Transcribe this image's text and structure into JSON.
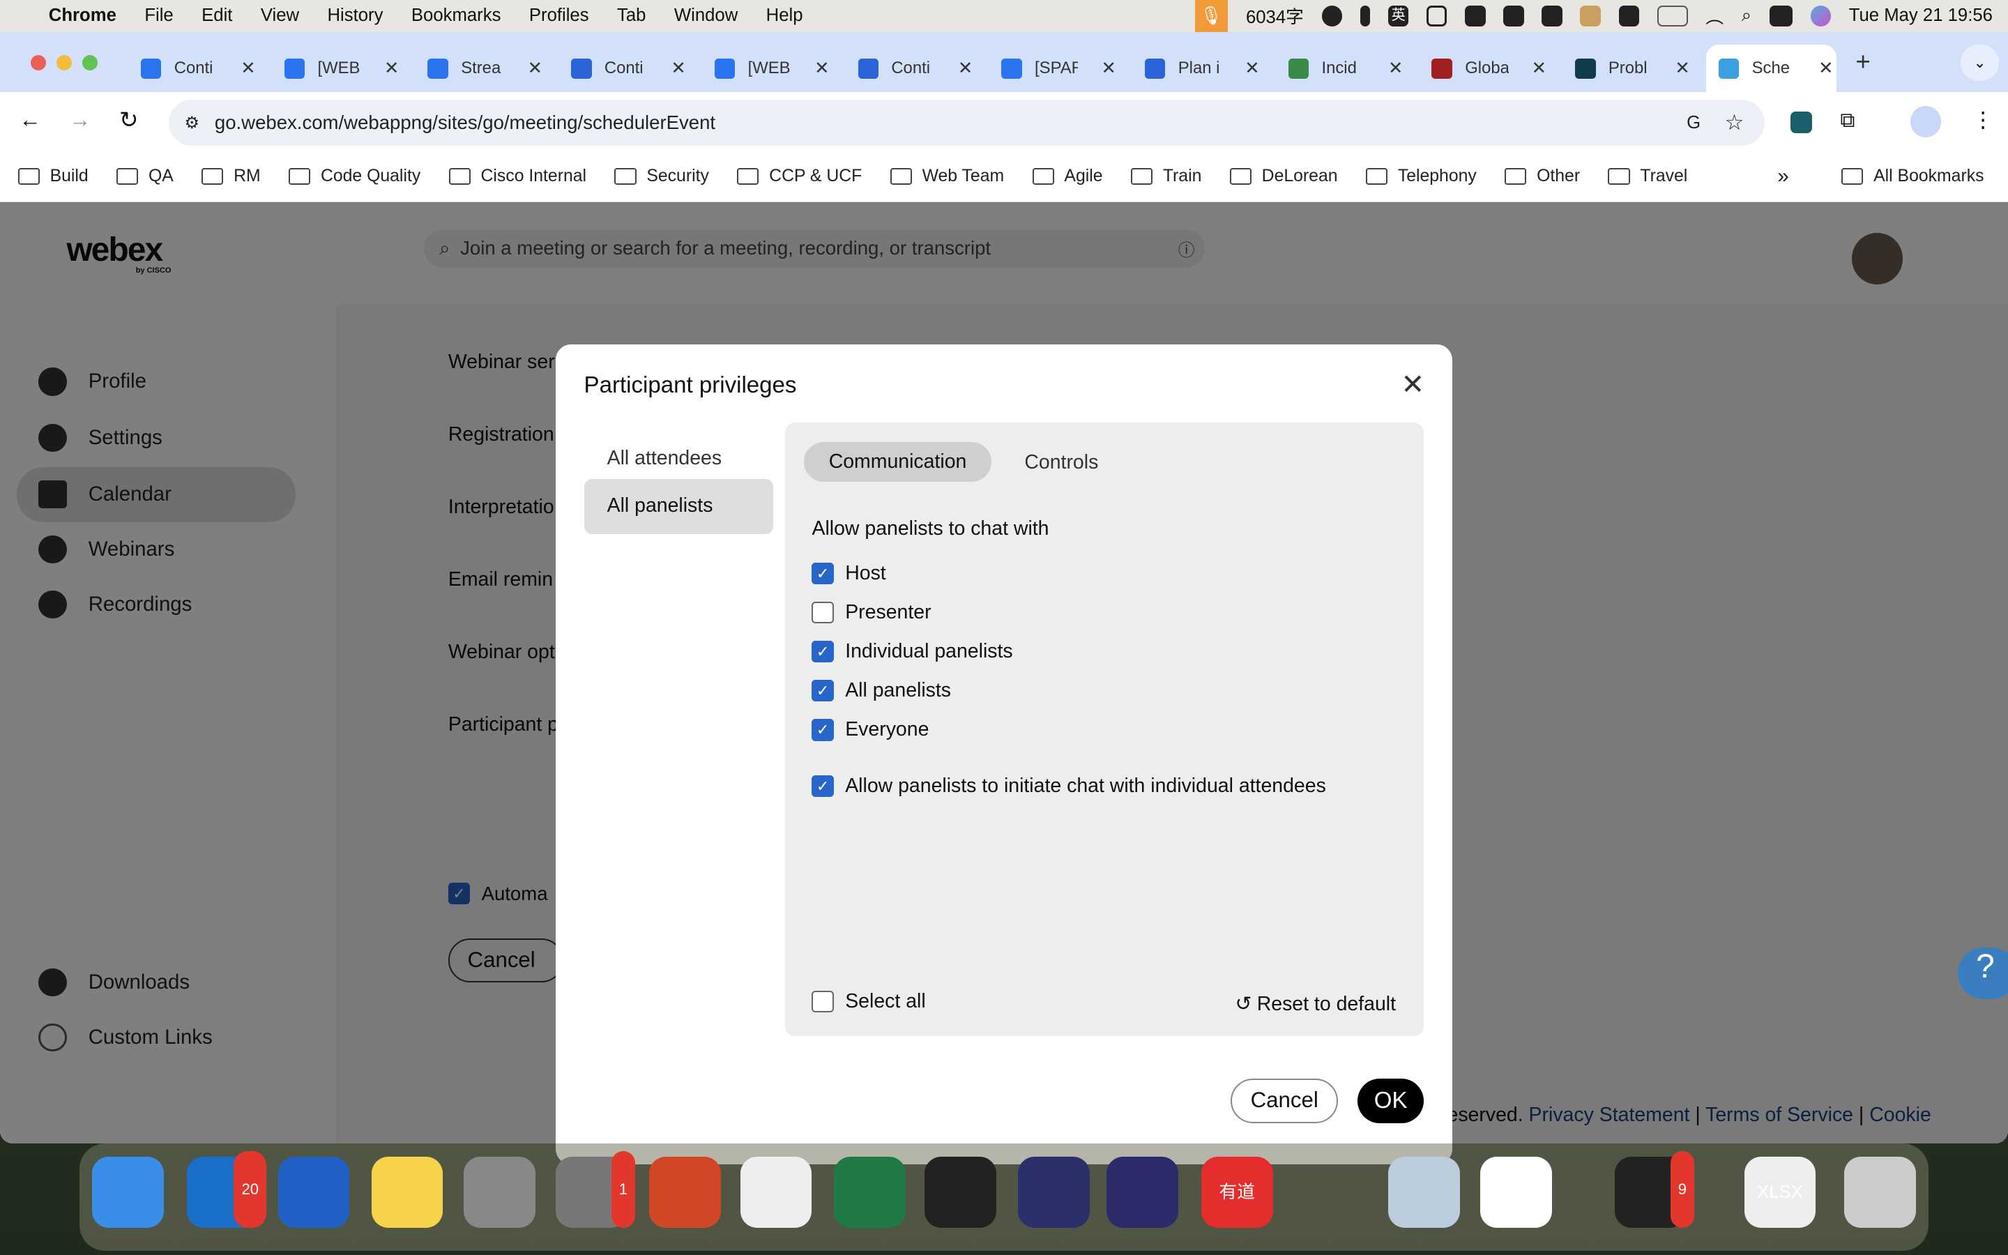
{
  "menubar": {
    "app": "Chrome",
    "items": [
      "File",
      "Edit",
      "View",
      "History",
      "Bookmarks",
      "Profiles",
      "Tab",
      "Window",
      "Help"
    ],
    "word_count": "6034字",
    "ime": "英",
    "datetime": "Tue May 21  19:56"
  },
  "tabs": [
    {
      "title": "Conti",
      "icon": "jira"
    },
    {
      "title": "[WEB",
      "icon": "jira"
    },
    {
      "title": "Strea",
      "icon": "jira"
    },
    {
      "title": "Conti",
      "icon": "confluence"
    },
    {
      "title": "[WEB",
      "icon": "jira"
    },
    {
      "title": "Conti",
      "icon": "confluence"
    },
    {
      "title": "[SPAR",
      "icon": "jira"
    },
    {
      "title": "Plan i",
      "icon": "confluence"
    },
    {
      "title": "Incid",
      "icon": "incident"
    },
    {
      "title": "Globa",
      "icon": "cisco"
    },
    {
      "title": "Probl",
      "icon": "problem"
    },
    {
      "title": "Sche",
      "icon": "webex",
      "active": true
    }
  ],
  "address": {
    "url": "go.webex.com/webappng/sites/go/meeting/schedulerEvent"
  },
  "bookmarks": [
    "Build",
    "QA",
    "RM",
    "Code Quality",
    "Cisco Internal",
    "Security",
    "CCP & UCF",
    "Web Team",
    "Agile",
    "Train",
    "DeLorean",
    "Telephony",
    "Other",
    "Travel"
  ],
  "all_bookmarks": "All Bookmarks",
  "webex": {
    "logo": "webex",
    "logo_sub": "by CISCO",
    "search_placeholder": "Join a meeting or search for a meeting, recording, or transcript",
    "sidebar": [
      {
        "label": "Profile"
      },
      {
        "label": "Settings"
      },
      {
        "label": "Calendar",
        "active": true
      },
      {
        "label": "Webinars"
      },
      {
        "label": "Recordings"
      }
    ],
    "sidebar_bottom": [
      {
        "label": "Downloads"
      },
      {
        "label": "Custom Links"
      }
    ],
    "sections": [
      "Webinar ser",
      "Registration",
      "Interpretatio",
      "Email remin",
      "Webinar opt",
      "Participant p"
    ],
    "auto_label": "Automa",
    "cancel": "Cancel",
    "footer": {
      "text": "eserved.",
      "links": [
        "Privacy Statement",
        "Terms of Service",
        "Cookie"
      ]
    }
  },
  "modal": {
    "title": "Participant privileges",
    "roles": [
      {
        "label": "All attendees"
      },
      {
        "label": "All panelists",
        "active": true
      }
    ],
    "tabs": [
      {
        "label": "Communication",
        "active": true
      },
      {
        "label": "Controls"
      }
    ],
    "heading": "Allow panelists to chat with",
    "options": [
      {
        "label": "Host",
        "checked": true
      },
      {
        "label": "Presenter",
        "checked": false
      },
      {
        "label": "Individual panelists",
        "checked": true
      },
      {
        "label": "All panelists",
        "checked": true
      },
      {
        "label": "Everyone",
        "checked": true
      }
    ],
    "initiate": {
      "label": "Allow panelists to initiate chat with individual attendees",
      "checked": true
    },
    "select_all": "Select all",
    "reset": "Reset to default",
    "cancel": "Cancel",
    "ok": "OK"
  },
  "dock": [
    {
      "name": "Finder"
    },
    {
      "name": "Outlook",
      "badge": "20"
    },
    {
      "name": "Word"
    },
    {
      "name": "Notes"
    },
    {
      "name": "Launchpad"
    },
    {
      "name": "System Settings",
      "badge": "1"
    },
    {
      "name": "PowerPoint"
    },
    {
      "name": "Chrome"
    },
    {
      "name": "Excel"
    },
    {
      "name": "Terminal"
    },
    {
      "name": "IntelliJ IDEA"
    },
    {
      "name": "Eclipse"
    },
    {
      "name": "Youdao",
      "text": "有道"
    },
    {
      "name": "Help"
    },
    {
      "name": "Preview"
    },
    {
      "name": "VPN"
    },
    {
      "name": "Webex",
      "badge": "9"
    },
    {
      "name": "XLSX file",
      "text": "XLSX"
    },
    {
      "name": "Trash"
    }
  ]
}
